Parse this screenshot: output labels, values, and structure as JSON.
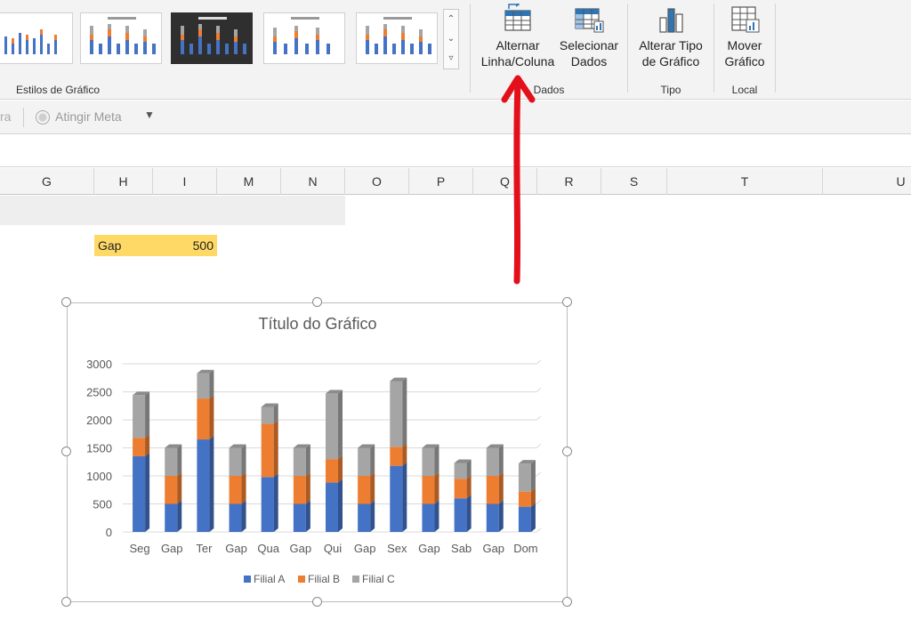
{
  "ribbon": {
    "chart_styles_label": "Estilos de Gráfico",
    "switch_row_col": "Alternar\nLinha/Coluna",
    "select_data": "Selecionar\nDados",
    "data_group": "Dados",
    "change_type": "Alterar Tipo\nde Gráfico",
    "type_group": "Tipo",
    "move_chart": "Mover\nGráfico",
    "location_group": "Local"
  },
  "toolbar": {
    "cut_text": "ra",
    "goal_seek": "Atingir Meta"
  },
  "columns": [
    "G",
    "H",
    "I",
    "M",
    "N",
    "O",
    "P",
    "Q",
    "R",
    "S",
    "T",
    "U"
  ],
  "cell": {
    "label": "Gap",
    "value": "500"
  },
  "chart_data": {
    "type": "bar",
    "stacked": true,
    "title": "Título do Gráfico",
    "categories": [
      "Seg",
      "Gap",
      "Ter",
      "Gap",
      "Qua",
      "Gap",
      "Qui",
      "Gap",
      "Sex",
      "Gap",
      "Sab",
      "Gap",
      "Dom"
    ],
    "series": [
      {
        "name": "Filial A",
        "color": "#4472c4",
        "values": [
          1350,
          500,
          1650,
          500,
          980,
          500,
          880,
          500,
          1180,
          500,
          600,
          500,
          450
        ]
      },
      {
        "name": "Filial B",
        "color": "#ed7d31",
        "values": [
          330,
          500,
          730,
          500,
          950,
          500,
          420,
          500,
          340,
          500,
          350,
          500,
          270
        ]
      },
      {
        "name": "Filial C",
        "color": "#a5a5a5",
        "values": [
          760,
          500,
          450,
          500,
          300,
          500,
          1170,
          500,
          1170,
          500,
          280,
          500,
          500
        ]
      }
    ],
    "ylim": [
      0,
      3000
    ],
    "yticks": [
      "0",
      "500",
      "1000",
      "1500",
      "2000",
      "2500",
      "3000"
    ],
    "legend_position": "bottom",
    "grid": true
  },
  "colors": {
    "arrow": "#e3101c",
    "highlight": "#ffd966",
    "accent_blue": "#2e75b6"
  }
}
